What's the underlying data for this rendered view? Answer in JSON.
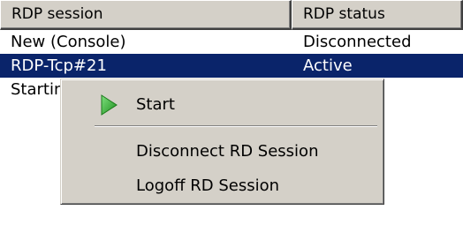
{
  "listview": {
    "columns": [
      {
        "label": "RDP session"
      },
      {
        "label": "RDP status"
      }
    ],
    "rows": [
      {
        "session": "New (Console)",
        "status": "Disconnected"
      },
      {
        "session": "RDP-Tcp#21",
        "status": "Active"
      },
      {
        "session": "Starting r",
        "status": ""
      }
    ]
  },
  "context_menu": {
    "start_label": "Start",
    "disconnect_label": "Disconnect RD Session",
    "logoff_label": "Logoff RD Session"
  },
  "colors": {
    "selection": "#0a246a",
    "menu_face": "#d4d0c8",
    "start_icon": "#2eb82e"
  },
  "icons": {
    "start": "play-triangle-icon"
  }
}
